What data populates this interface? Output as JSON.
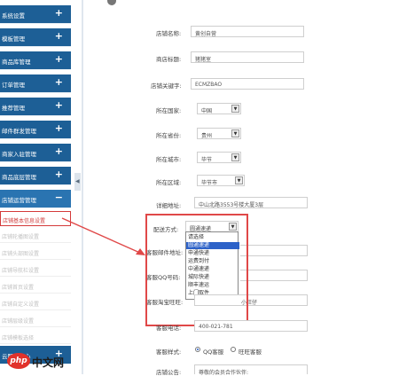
{
  "sidebar": {
    "items": [
      {
        "label": "系统设置",
        "sign": "+"
      },
      {
        "label": "模板管理",
        "sign": "+"
      },
      {
        "label": "商品库管理",
        "sign": "+"
      },
      {
        "label": "订单管理",
        "sign": "+"
      },
      {
        "label": "推荐管理",
        "sign": "+"
      },
      {
        "label": "邮件群发管理",
        "sign": "+"
      },
      {
        "label": "商家入驻管理",
        "sign": "+"
      },
      {
        "label": "商品底层管理",
        "sign": "+"
      },
      {
        "label": "店铺运营管理",
        "sign": "−"
      }
    ],
    "subitems": [
      {
        "label": "店铺基本信息设置"
      },
      {
        "label": "店铺轮播图设置"
      },
      {
        "label": "店铺头部图设置"
      },
      {
        "label": "店铺导航栏设置"
      },
      {
        "label": "店铺首页设置"
      },
      {
        "label": "店铺自定义设置"
      },
      {
        "label": "店铺层级设置"
      },
      {
        "label": "店铺模板选择"
      }
    ],
    "last_item": {
      "label": "云服务中心",
      "sign": "+"
    },
    "collapse_glyph": "◀"
  },
  "form": {
    "store_name": {
      "label": "店铺名称:",
      "value": "黄创自营"
    },
    "store_title": {
      "label": "商店标题:",
      "value": "猪猪室"
    },
    "store_keywords": {
      "label": "店铺关键字:",
      "value": "ECMZBAO"
    },
    "country": {
      "label": "所在国家:",
      "value": "中国"
    },
    "province": {
      "label": "所在省份:",
      "value": "贵州"
    },
    "city": {
      "label": "所在城市:",
      "value": "毕节"
    },
    "district": {
      "label": "所在区域:",
      "value": "毕节市"
    },
    "address": {
      "label": "详细地址:",
      "value": "中山北路3553号楼大厦3层"
    },
    "shipping": {
      "label": "配送方式:",
      "value": "圆通速递",
      "options": [
        "请选择",
        "圆通速递",
        "申通快递",
        "运费到付",
        "中通速递",
        "城际快递",
        "顺丰速运",
        "上门取件"
      ],
      "selected_index": 1
    },
    "service_email": {
      "label": "客服邮件地址:"
    },
    "service_qq": {
      "label": "客服QQ号码:"
    },
    "service_ww": {
      "label": "客服淘宝旺旺:",
      "value": "小旺仔"
    },
    "service_phone": {
      "label": "客服电话:",
      "value": "400-021-781"
    },
    "service_type": {
      "label": "客服样式:",
      "options": [
        "QQ客服",
        "旺旺客服"
      ]
    },
    "notice": {
      "label": "店铺公告:",
      "value": "尊敬的会员合作伙伴:"
    }
  },
  "top_title": "",
  "watermark": {
    "logo": "php",
    "text": "中文网",
    "url": ""
  }
}
